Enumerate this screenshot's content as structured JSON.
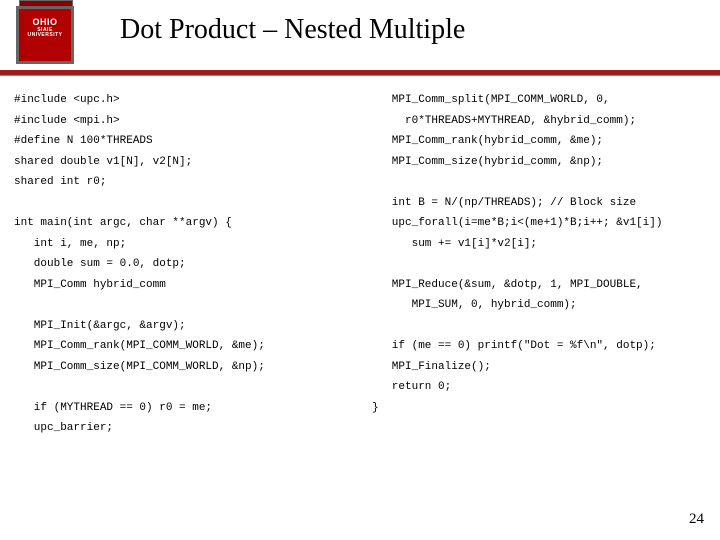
{
  "header": {
    "logo_main": "OHIO",
    "logo_sub1": "SIAIE",
    "logo_sub2": "UNIVERSITY",
    "title": "Dot Product – Nested Multiple"
  },
  "code": {
    "left": "#include <upc.h>\n#include <mpi.h>\n#define N 100*THREADS\nshared double v1[N], v2[N];\nshared int r0;\n\nint main(int argc, char **argv) {\n   int i, me, np;\n   double sum = 0.0, dotp;\n   MPI_Comm hybrid_comm\n\n   MPI_Init(&argc, &argv);\n   MPI_Comm_rank(MPI_COMM_WORLD, &me);\n   MPI_Comm_size(MPI_COMM_WORLD, &np);\n\n   if (MYTHREAD == 0) r0 = me;\n   upc_barrier;",
    "right": "   MPI_Comm_split(MPI_COMM_WORLD, 0,\n     r0*THREADS+MYTHREAD, &hybrid_comm);\n   MPI_Comm_rank(hybrid_comm, &me);\n   MPI_Comm_size(hybrid_comm, &np);\n\n   int B = N/(np/THREADS); // Block size\n   upc_forall(i=me*B;i<(me+1)*B;i++; &v1[i])\n      sum += v1[i]*v2[i];\n\n   MPI_Reduce(&sum, &dotp, 1, MPI_DOUBLE,\n      MPI_SUM, 0, hybrid_comm);\n\n   if (me == 0) printf(\"Dot = %f\\n\", dotp);\n   MPI_Finalize();\n   return 0;\n}"
  },
  "page_number": "24"
}
